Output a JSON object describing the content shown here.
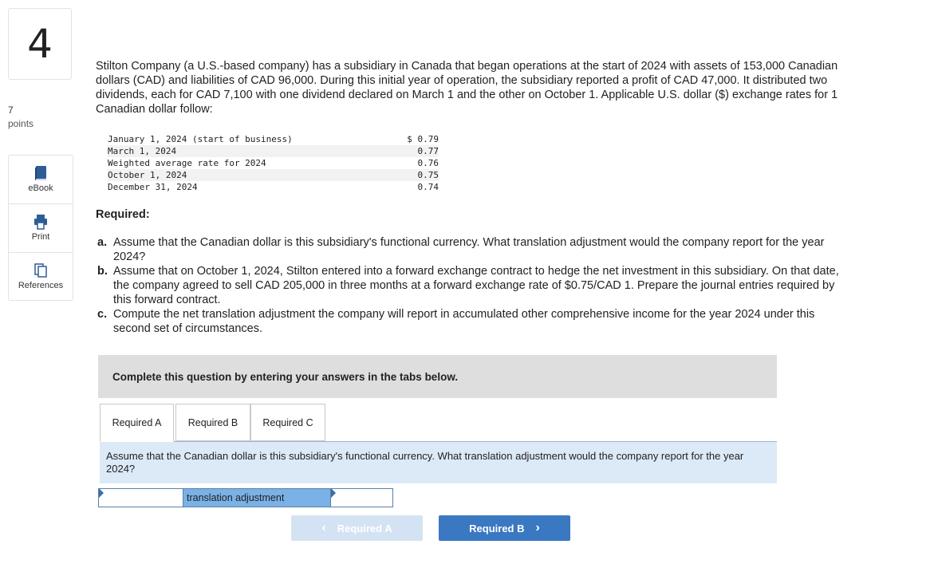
{
  "question": {
    "number": "4",
    "points_value": "7",
    "points_label": "points"
  },
  "tools": [
    {
      "label": "eBook",
      "icon": "book-icon"
    },
    {
      "label": "Print",
      "icon": "printer-icon"
    },
    {
      "label": "References",
      "icon": "references-icon"
    }
  ],
  "prompt": "Stilton Company (a U.S.-based company) has a subsidiary in Canada that began operations at the start of 2024 with assets of 153,000 Canadian dollars (CAD) and liabilities of CAD 96,000. During this initial year of operation, the subsidiary reported a profit of CAD 47,000. It distributed two dividends, each for CAD 7,100 with one dividend declared on March 1 and the other on October 1. Applicable U.S. dollar ($) exchange rates for 1 Canadian dollar follow:",
  "rates": [
    {
      "date": "January 1, 2024 (start of business)",
      "value": "$ 0.79"
    },
    {
      "date": "March 1, 2024",
      "value": "0.77"
    },
    {
      "date": "Weighted average rate for 2024",
      "value": "0.76"
    },
    {
      "date": "October 1, 2024",
      "value": "0.75"
    },
    {
      "date": "December 31, 2024",
      "value": "0.74"
    }
  ],
  "required_header": "Required:",
  "requirements": [
    {
      "letter": "a.",
      "text": "Assume that the Canadian dollar is this subsidiary's functional currency. What translation adjustment would the company report for the year 2024?"
    },
    {
      "letter": "b.",
      "text": "Assume that on October 1, 2024, Stilton entered into a forward exchange contract to hedge the net investment in this subsidiary. On that date, the company agreed to sell CAD 205,000 in three months at a forward exchange rate of $0.75/CAD 1. Prepare the journal entries required by this forward contract."
    },
    {
      "letter": "c.",
      "text": "Compute the net translation adjustment the company will report in accumulated other comprehensive income for the year 2024 under this second set of circumstances."
    }
  ],
  "banner": "Complete this question by entering your answers in the tabs below.",
  "tabs": [
    {
      "label": "Required A",
      "active": true
    },
    {
      "label": "Required B",
      "active": false
    },
    {
      "label": "Required C",
      "active": false
    }
  ],
  "panel_text": "Assume that the Canadian dollar is this subsidiary's functional currency. What translation adjustment would the company report for the year 2024?",
  "answer_row": {
    "label": "translation adjustment",
    "left_value": "",
    "right_value": ""
  },
  "nav": {
    "prev_label": "Required A",
    "next_label": "Required B"
  },
  "colors": {
    "accent": "#3a78c2",
    "panel_bg": "#dce9f7",
    "label_bg": "#7ab1e6",
    "banner_bg": "#dedede"
  }
}
